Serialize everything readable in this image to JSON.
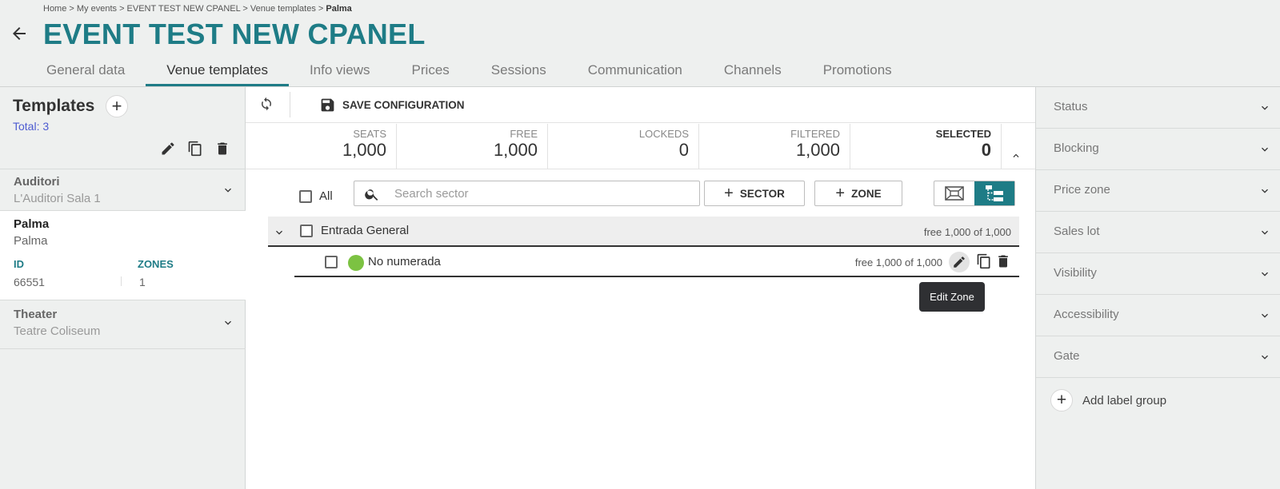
{
  "breadcrumb": {
    "trail": "Home > My events > EVENT TEST NEW CPANEL > Venue templates > ",
    "current": "Palma"
  },
  "page_title": "EVENT TEST NEW CPANEL",
  "tabs": [
    {
      "label": "General data"
    },
    {
      "label": "Venue templates"
    },
    {
      "label": "Info views"
    },
    {
      "label": "Prices"
    },
    {
      "label": "Sessions"
    },
    {
      "label": "Communication"
    },
    {
      "label": "Channels"
    },
    {
      "label": "Promotions"
    }
  ],
  "templates": {
    "title": "Templates",
    "total": "Total: 3",
    "items": [
      {
        "name": "Auditori",
        "sub": "L'Auditori Sala 1"
      },
      {
        "name": "Palma",
        "sub": "Palma",
        "id_label": "ID",
        "id_value": "66551",
        "zones_label": "ZONES",
        "zones_value": "1"
      },
      {
        "name": "Theater",
        "sub": "Teatre Coliseum"
      }
    ]
  },
  "toolbar": {
    "save_label": "SAVE CONFIGURATION"
  },
  "stats": [
    {
      "label": "SEATS",
      "value": "1,000"
    },
    {
      "label": "FREE",
      "value": "1,000"
    },
    {
      "label": "LOCKEDS",
      "value": "0"
    },
    {
      "label": "FILTERED",
      "value": "1,000"
    },
    {
      "label": "SELECTED",
      "value": "0"
    }
  ],
  "filters": {
    "all_label": "All",
    "search_placeholder": "Search sector",
    "sector_button": "SECTOR",
    "zone_button": "ZONE"
  },
  "sector": {
    "name": "Entrada General",
    "free_text": "free 1,000 of 1,000"
  },
  "zone": {
    "name": "No numerada",
    "free_text": "free 1,000 of 1,000",
    "color": "#7cc242"
  },
  "tooltip": "Edit Zone",
  "right_filters": [
    "Status",
    "Blocking",
    "Price zone",
    "Sales lot",
    "Visibility",
    "Accessibility",
    "Gate"
  ],
  "add_label_group": "Add label group",
  "colors": {
    "accent": "#1e7c86",
    "total": "#4d5bd1"
  }
}
